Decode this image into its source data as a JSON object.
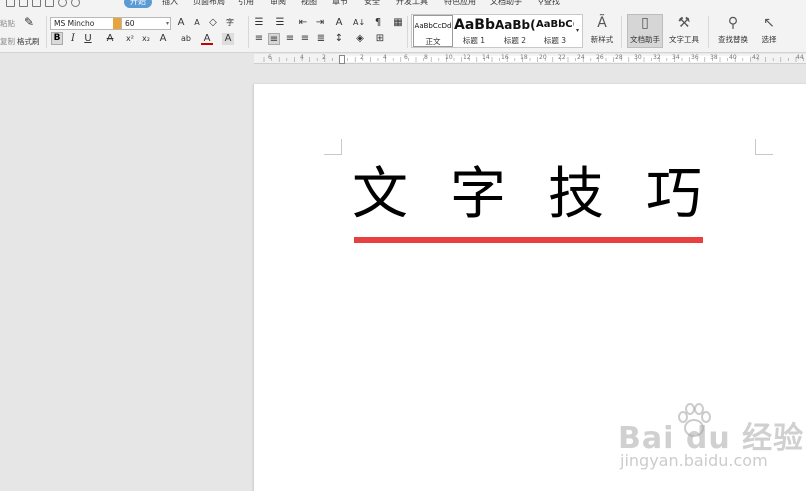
{
  "menubar": {
    "tabs": [
      "开始",
      "插入",
      "页面布局",
      "引用",
      "审阅",
      "视图",
      "章节",
      "安全",
      "开发工具",
      "特色应用",
      "文档助手",
      "查找"
    ],
    "active_tab": "开始"
  },
  "ribbon": {
    "paste_labels": [
      "粘贴",
      "复制"
    ],
    "format_painter": "格式刷",
    "font_name": "MS Mincho",
    "font_size": "60",
    "bold": "B",
    "italic": "I",
    "underline": "U",
    "styles": [
      {
        "sample": "AaBbCcDd",
        "name": "正文"
      },
      {
        "sample": "AaBb",
        "name": "标题 1"
      },
      {
        "sample": "AaBb(",
        "name": "标题 2"
      },
      {
        "sample": "AaBbC(",
        "name": "标题 3"
      }
    ],
    "new_style": "新样式",
    "doc_assistant": "文档助手",
    "text_tools": "文字工具",
    "find_replace": "查找替换",
    "select": "选择"
  },
  "ruler": {
    "labels": [
      "6",
      "4",
      "2",
      "2",
      "4",
      "6",
      "8",
      "10",
      "12",
      "14",
      "16",
      "18",
      "20",
      "22",
      "24",
      "26",
      "28",
      "30",
      "32",
      "34",
      "36",
      "38",
      "40",
      "42",
      "44"
    ]
  },
  "document": {
    "heading": "文字技巧",
    "underline_color": "#e84040"
  },
  "watermark": {
    "logo": "Bai  du 经验",
    "url": "jingyan.baidu.com"
  },
  "colors": {
    "accent": "#5b9bd5",
    "workspace": "#e6e6e6",
    "underline": "#e84040"
  },
  "icons": [
    "save-icon",
    "undo-icon",
    "redo-icon",
    "print-icon",
    "format-painter-icon",
    "clear-format-icon",
    "bullets-icon",
    "numbering-icon",
    "align-left-icon",
    "align-center-icon",
    "align-right-icon",
    "justify-icon",
    "new-style-icon",
    "doc-assistant-icon",
    "text-tools-icon",
    "search-icon",
    "cursor-select-icon"
  ]
}
